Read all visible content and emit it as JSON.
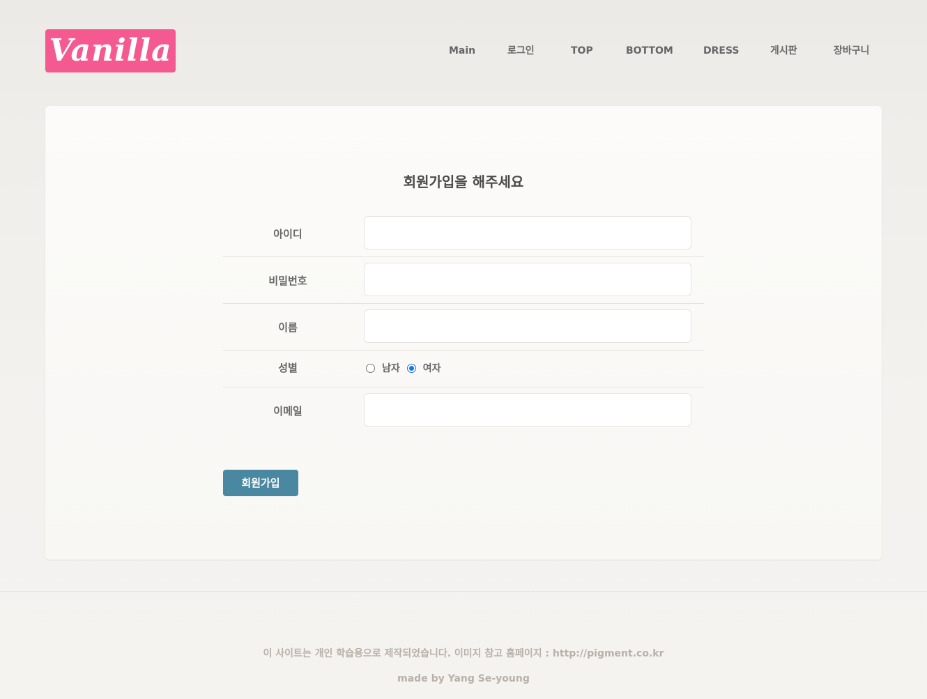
{
  "header": {
    "logo_text": "Vanilla",
    "nav": [
      {
        "label": "Main"
      },
      {
        "label": "로그인"
      },
      {
        "label": "TOP"
      },
      {
        "label": "BOTTOM"
      },
      {
        "label": "DRESS"
      },
      {
        "label": "게시판"
      },
      {
        "label": "장바구니"
      }
    ]
  },
  "form": {
    "title": "회원가입을 해주세요",
    "fields": {
      "id": {
        "label": "아이디",
        "value": ""
      },
      "password": {
        "label": "비밀번호",
        "value": ""
      },
      "name": {
        "label": "이름",
        "value": ""
      },
      "gender": {
        "label": "성별",
        "options": [
          "남자",
          "여자"
        ],
        "selected": "여자"
      },
      "email": {
        "label": "이메일",
        "value": ""
      }
    },
    "submit_label": "회원가입"
  },
  "footer": {
    "notice": "이 사이트는 개인 학습용으로 제작되었습니다. 이미지 참고 홈페이지 : http://pigment.co.kr",
    "credit": "made by Yang Se-young"
  },
  "colors": {
    "logo_bg": "#f4598f",
    "button_bg": "#4a87a0",
    "radio_selected": "#1a73e8"
  }
}
